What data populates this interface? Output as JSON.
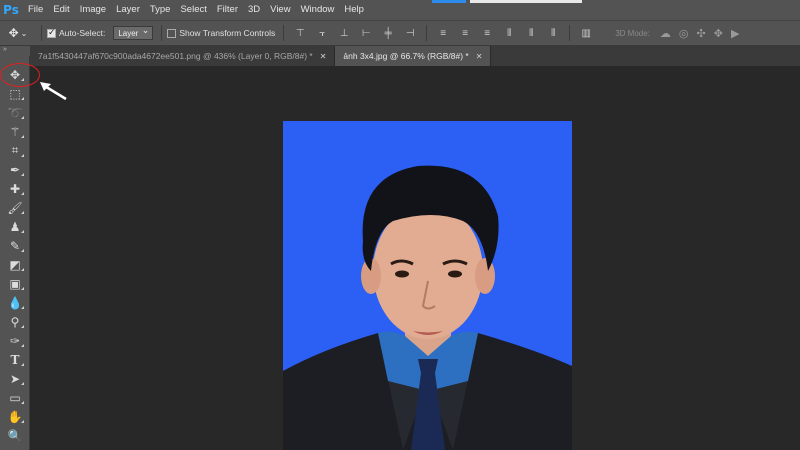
{
  "app": {
    "logo": "Ps"
  },
  "menu": [
    "File",
    "Edit",
    "Image",
    "Layer",
    "Type",
    "Select",
    "Filter",
    "3D",
    "View",
    "Window",
    "Help"
  ],
  "options": {
    "auto_select_label": "Auto-Select:",
    "auto_select_checked": true,
    "layer_dropdown_value": "Layer",
    "show_transform_label": "Show Transform Controls",
    "show_transform_checked": false,
    "mode_3d_label": "3D Mode:"
  },
  "tabs": [
    {
      "label": "7a1f5430447af670c900ada4672ee501.png @ 436% (Layer 0, RGB/8#) *",
      "active": false
    },
    {
      "label": "ảnh 3x4.jpg @ 66.7% (RGB/8#) *",
      "active": true
    }
  ],
  "tools": [
    "move-tool",
    "marquee-tool",
    "lasso-tool",
    "magic-wand-tool",
    "crop-tool",
    "eyedropper-tool",
    "healing-brush-tool",
    "brush-tool",
    "clone-stamp-tool",
    "history-brush-tool",
    "eraser-tool",
    "gradient-tool",
    "blur-tool",
    "dodge-tool",
    "pen-tool",
    "type-tool",
    "path-selection-tool",
    "rectangle-tool",
    "hand-tool",
    "zoom-tool"
  ],
  "canvas": {
    "background_color": "#2c5ff4"
  },
  "colors": {
    "ui_panel": "#535353",
    "workspace": "#282828",
    "highlight_circle": "#e02020"
  }
}
